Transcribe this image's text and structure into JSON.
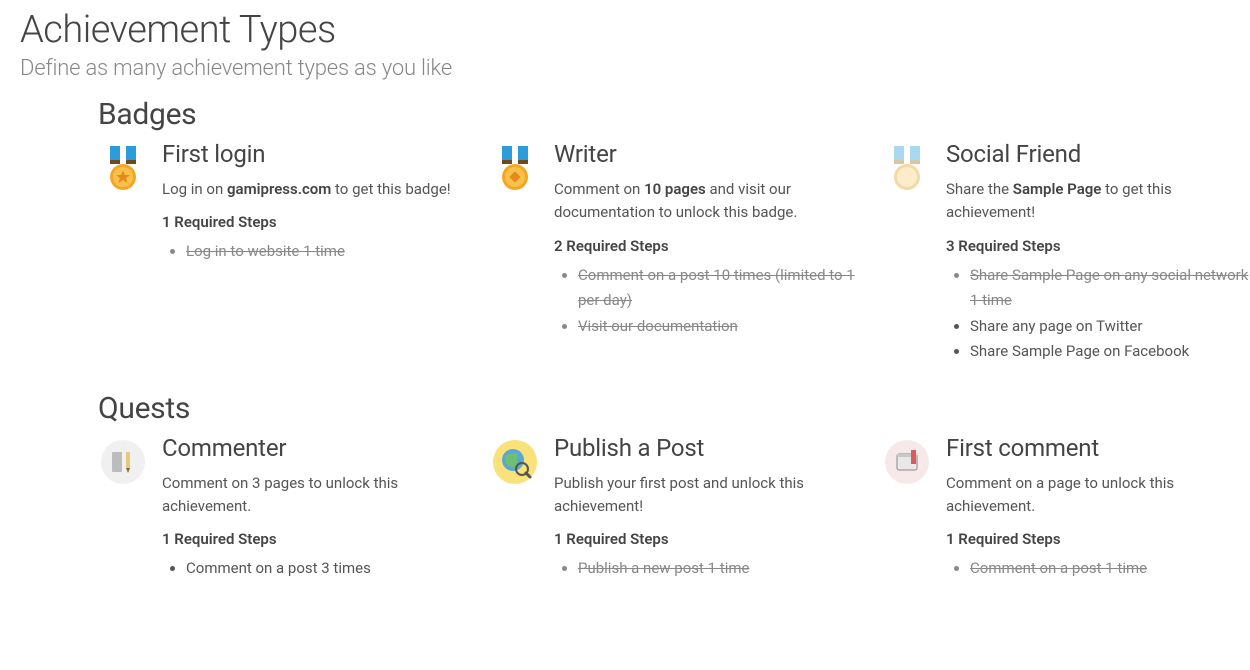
{
  "page": {
    "title": "Achievement Types",
    "subtitle": "Define as many achievement types as you like"
  },
  "sections": [
    {
      "title": "Badges",
      "cards": [
        {
          "icon": "medal-gold-star",
          "title": "First login",
          "desc_html": "Log in on <strong>gamipress.com</strong> to get this badge!",
          "steps_count": 1,
          "steps_label": "1 Required Steps",
          "steps": [
            {
              "text": "Log in to website 1 time",
              "done": true
            }
          ]
        },
        {
          "icon": "medal-gold-pencil",
          "title": "Writer",
          "desc_html": "Comment on <strong>10 pages</strong> and visit our documentation to unlock this badge.",
          "steps_count": 2,
          "steps_label": "2 Required Steps",
          "steps": [
            {
              "text": "Comment on a post 10 times (limited to 1 per day)",
              "done": true
            },
            {
              "text": "Visit our documentation",
              "done": true
            }
          ]
        },
        {
          "icon": "medal-light",
          "title": "Social Friend",
          "desc_html": "Share the <strong>Sample Page</strong> to get this achievement!",
          "steps_count": 3,
          "steps_label": "3 Required Steps",
          "steps": [
            {
              "text": "Share Sample Page on any social network 1 time",
              "done": true
            },
            {
              "text": "Share any page on Twitter",
              "done": false
            },
            {
              "text": "Share Sample Page on Facebook",
              "done": false
            }
          ]
        }
      ]
    },
    {
      "title": "Quests",
      "cards": [
        {
          "icon": "commenter-icon",
          "title": "Commenter",
          "desc_html": "Comment on 3 pages to unlock this achievement.",
          "steps_count": 1,
          "steps_label": "1 Required Steps",
          "steps": [
            {
              "text": "Comment on a post 3 times",
              "done": false
            }
          ]
        },
        {
          "icon": "globe-search-icon",
          "title": "Publish a Post",
          "desc_html": "Publish your first post and unlock this achievement!",
          "steps_count": 1,
          "steps_label": "1 Required Steps",
          "steps": [
            {
              "text": "Publish a new post 1 time",
              "done": true
            }
          ]
        },
        {
          "icon": "bookmark-book-icon",
          "title": "First comment",
          "desc_html": "Comment on a page to unlock this achievement.",
          "steps_count": 1,
          "steps_label": "1 Required Steps",
          "steps": [
            {
              "text": "Comment on a post 1 time",
              "done": true
            }
          ]
        }
      ]
    }
  ]
}
